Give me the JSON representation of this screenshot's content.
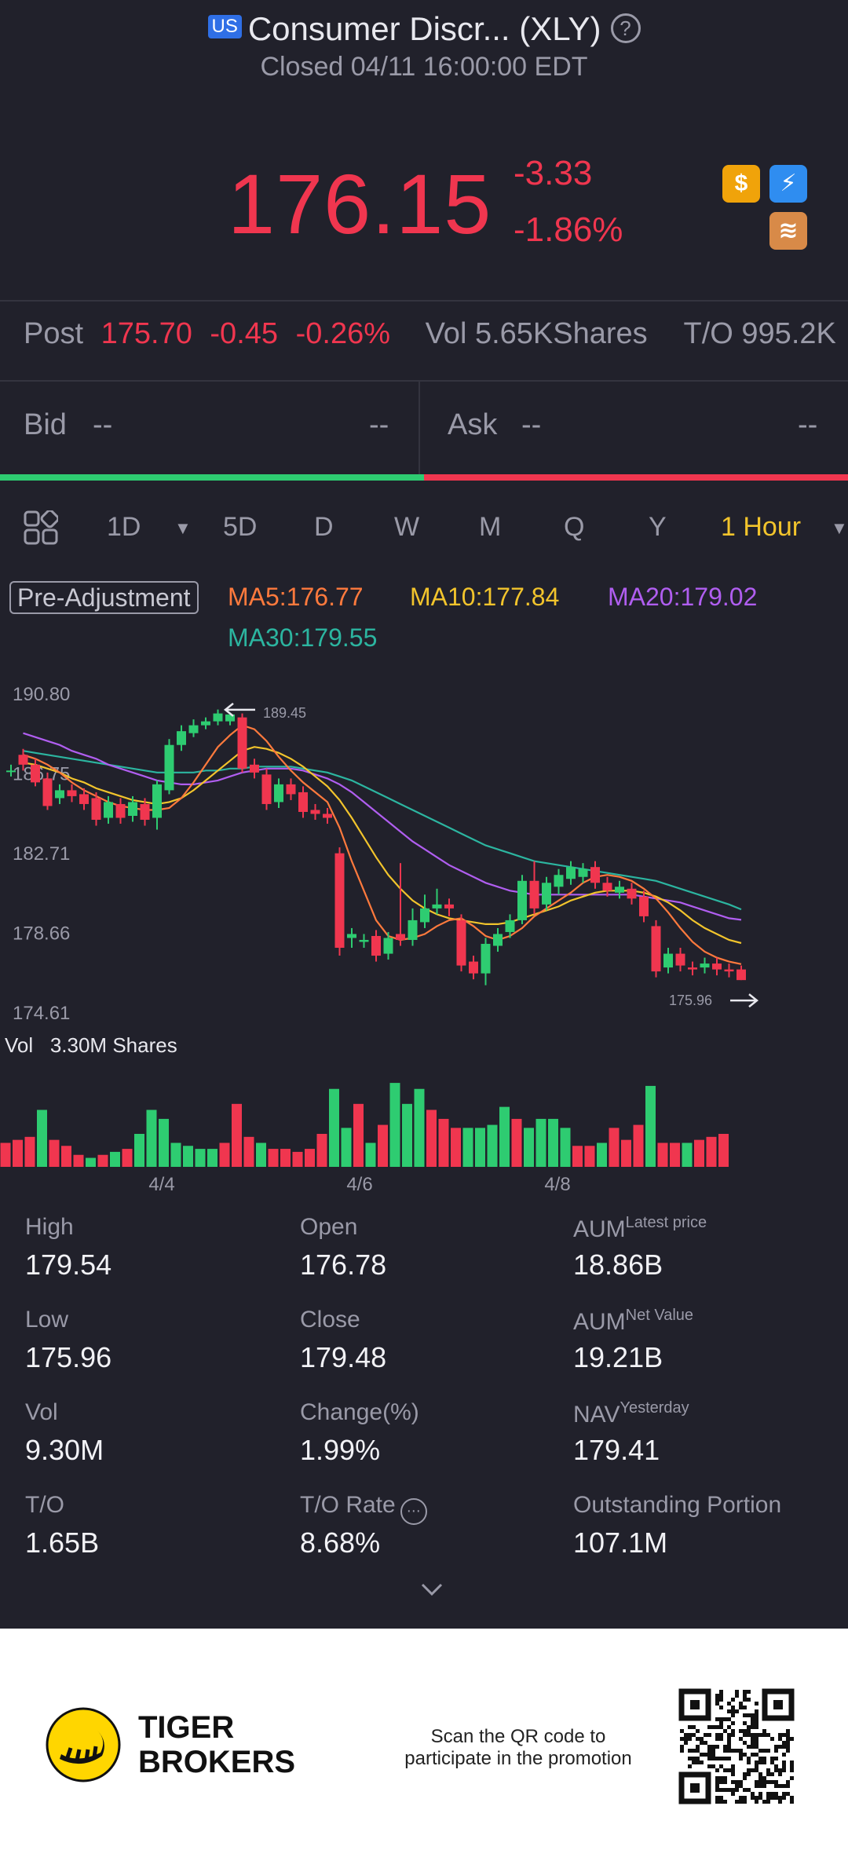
{
  "header": {
    "market_badge": "US",
    "title": "Consumer Discr... (XLY)",
    "status": "Closed 04/11 16:00:00 EDT"
  },
  "quote": {
    "price": "176.15",
    "change": "-3.33",
    "change_pct": "-1.86%"
  },
  "icons": {
    "dollar": "$",
    "flash": "⚡",
    "layers": "≋"
  },
  "post": {
    "label": "Post",
    "price": "175.70",
    "change": "-0.45",
    "change_pct": "-0.26%",
    "vol": "Vol 5.65KShares",
    "turnover": "T/O 995.2K"
  },
  "book": {
    "bid_label": "Bid",
    "bid_value": "--",
    "bid_size": "--",
    "ask_label": "Ask",
    "ask_value": "--",
    "ask_size": "--"
  },
  "tabs": {
    "t1": "1D",
    "t2": "5D",
    "t3": "D",
    "t4": "W",
    "t5": "M",
    "t6": "Q",
    "t7": "Y",
    "active": "1 Hour"
  },
  "ma": {
    "adjust": "Pre-Adjustment",
    "ma5": "MA5:176.77",
    "ma10": "MA10:177.84",
    "ma20": "MA20:179.02",
    "ma30": "MA30:179.55"
  },
  "colors": {
    "up": "#2ecc71",
    "down": "#f0364f",
    "ma5": "#ff7a3d",
    "ma10": "#f2c42c",
    "ma20": "#b05ef0",
    "ma30": "#2cb5a0",
    "accent_tab": "#f2c42c"
  },
  "chart_data": {
    "type": "candlestick",
    "y_ticks": [
      "190.80",
      "186.75",
      "182.71",
      "178.66",
      "174.61"
    ],
    "ylim": [
      174.61,
      190.8
    ],
    "high_marker": "189.45",
    "low_marker": "175.96",
    "x_ticks": [
      "4/4",
      "4/6",
      "4/8"
    ],
    "volume_label": "Vol",
    "volume_max": "3.30M Shares",
    "candles": [
      {
        "o": 186.6,
        "c": 186.6,
        "h": 186.9,
        "l": 186.3
      },
      {
        "o": 187.4,
        "c": 186.9,
        "h": 187.7,
        "l": 186.6
      },
      {
        "o": 186.9,
        "c": 186.0,
        "h": 187.2,
        "l": 185.8
      },
      {
        "o": 186.2,
        "c": 184.8,
        "h": 186.5,
        "l": 184.6
      },
      {
        "o": 185.2,
        "c": 185.6,
        "h": 185.9,
        "l": 184.9
      },
      {
        "o": 185.6,
        "c": 185.3,
        "h": 185.9,
        "l": 185.0
      },
      {
        "o": 185.4,
        "c": 184.9,
        "h": 185.7,
        "l": 184.6
      },
      {
        "o": 185.2,
        "c": 184.1,
        "h": 185.5,
        "l": 183.8
      },
      {
        "o": 184.2,
        "c": 185.0,
        "h": 185.3,
        "l": 183.9
      },
      {
        "o": 184.9,
        "c": 184.2,
        "h": 185.2,
        "l": 183.9
      },
      {
        "o": 184.3,
        "c": 185.0,
        "h": 185.3,
        "l": 184.0
      },
      {
        "o": 184.9,
        "c": 184.1,
        "h": 185.2,
        "l": 183.8
      },
      {
        "o": 184.2,
        "c": 185.9,
        "h": 186.1,
        "l": 183.6
      },
      {
        "o": 185.6,
        "c": 187.9,
        "h": 188.2,
        "l": 185.4
      },
      {
        "o": 187.9,
        "c": 188.6,
        "h": 188.9,
        "l": 187.6
      },
      {
        "o": 188.5,
        "c": 188.9,
        "h": 189.2,
        "l": 188.3
      },
      {
        "o": 188.9,
        "c": 189.1,
        "h": 189.3,
        "l": 188.7
      },
      {
        "o": 189.1,
        "c": 189.5,
        "h": 189.7,
        "l": 188.9
      },
      {
        "o": 189.1,
        "c": 189.45,
        "h": 189.45,
        "l": 188.9
      },
      {
        "o": 189.3,
        "c": 186.7,
        "h": 189.5,
        "l": 186.5
      },
      {
        "o": 186.9,
        "c": 186.5,
        "h": 187.2,
        "l": 186.2
      },
      {
        "o": 186.4,
        "c": 184.9,
        "h": 186.7,
        "l": 184.6
      },
      {
        "o": 185.0,
        "c": 185.9,
        "h": 186.2,
        "l": 184.7
      },
      {
        "o": 185.9,
        "c": 185.4,
        "h": 186.2,
        "l": 185.1
      },
      {
        "o": 185.5,
        "c": 184.5,
        "h": 185.8,
        "l": 184.2
      },
      {
        "o": 184.6,
        "c": 184.4,
        "h": 184.9,
        "l": 184.1
      },
      {
        "o": 184.4,
        "c": 184.2,
        "h": 184.7,
        "l": 183.9
      },
      {
        "o": 182.4,
        "c": 177.6,
        "h": 182.7,
        "l": 177.2
      },
      {
        "o": 178.1,
        "c": 178.3,
        "h": 178.6,
        "l": 177.6
      },
      {
        "o": 177.9,
        "c": 178.0,
        "h": 178.3,
        "l": 177.6
      },
      {
        "o": 178.2,
        "c": 177.2,
        "h": 178.5,
        "l": 176.9
      },
      {
        "o": 177.3,
        "c": 178.1,
        "h": 178.4,
        "l": 177.0
      },
      {
        "o": 178.3,
        "c": 178.0,
        "h": 181.9,
        "l": 177.7
      },
      {
        "o": 178.0,
        "c": 179.0,
        "h": 179.6,
        "l": 177.7
      },
      {
        "o": 178.9,
        "c": 179.6,
        "h": 180.3,
        "l": 178.6
      },
      {
        "o": 179.6,
        "c": 179.8,
        "h": 180.6,
        "l": 179.3
      },
      {
        "o": 179.8,
        "c": 179.6,
        "h": 180.1,
        "l": 179.2
      },
      {
        "o": 179.0,
        "c": 176.7,
        "h": 179.3,
        "l": 176.4
      },
      {
        "o": 176.9,
        "c": 176.3,
        "h": 177.2,
        "l": 176.0
      },
      {
        "o": 176.3,
        "c": 177.8,
        "h": 178.1,
        "l": 175.7
      },
      {
        "o": 177.7,
        "c": 178.3,
        "h": 178.6,
        "l": 177.4
      },
      {
        "o": 178.4,
        "c": 179.0,
        "h": 179.3,
        "l": 178.1
      },
      {
        "o": 179.0,
        "c": 181.0,
        "h": 181.3,
        "l": 178.8
      },
      {
        "o": 181.0,
        "c": 179.6,
        "h": 182.0,
        "l": 179.3
      },
      {
        "o": 179.8,
        "c": 180.9,
        "h": 181.2,
        "l": 179.5
      },
      {
        "o": 180.7,
        "c": 181.3,
        "h": 181.6,
        "l": 180.3
      },
      {
        "o": 181.1,
        "c": 181.7,
        "h": 182.0,
        "l": 180.8
      },
      {
        "o": 181.2,
        "c": 181.6,
        "h": 181.9,
        "l": 180.9
      },
      {
        "o": 181.7,
        "c": 180.9,
        "h": 182.0,
        "l": 180.6
      },
      {
        "o": 180.9,
        "c": 180.5,
        "h": 181.2,
        "l": 180.2
      },
      {
        "o": 180.4,
        "c": 180.7,
        "h": 181.0,
        "l": 180.1
      },
      {
        "o": 180.6,
        "c": 180.1,
        "h": 180.9,
        "l": 179.8
      },
      {
        "o": 180.2,
        "c": 179.2,
        "h": 180.5,
        "l": 178.9
      },
      {
        "o": 178.7,
        "c": 176.4,
        "h": 179.0,
        "l": 176.1
      },
      {
        "o": 176.6,
        "c": 177.3,
        "h": 177.6,
        "l": 176.3
      },
      {
        "o": 177.3,
        "c": 176.7,
        "h": 177.6,
        "l": 176.4
      },
      {
        "o": 176.6,
        "c": 176.5,
        "h": 176.9,
        "l": 176.2
      },
      {
        "o": 176.6,
        "c": 176.8,
        "h": 177.1,
        "l": 176.3
      },
      {
        "o": 176.8,
        "c": 176.5,
        "h": 177.1,
        "l": 176.2
      },
      {
        "o": 176.5,
        "c": 176.4,
        "h": 176.8,
        "l": 176.1
      },
      {
        "o": 176.5,
        "c": 175.96,
        "h": 176.7,
        "l": 175.96
      }
    ],
    "ma_lines": {
      "ma5": [
        187.4,
        187.2,
        186.9,
        186.5,
        186.0,
        185.6,
        185.3,
        185.0,
        184.8,
        184.7,
        184.6,
        184.6,
        184.7,
        185.2,
        186.0,
        186.9,
        187.8,
        188.4,
        188.9,
        188.7,
        188.1,
        187.3,
        186.6,
        186.0,
        185.5,
        185.0,
        183.7,
        182.0,
        180.5,
        179.0,
        178.2,
        178.0,
        178.1,
        178.3,
        178.7,
        179.0,
        179.1,
        178.7,
        178.2,
        178.0,
        178.2,
        178.6,
        179.2,
        179.6,
        180.0,
        180.4,
        180.9,
        181.2,
        181.3,
        181.2,
        181.0,
        180.6,
        180.1,
        179.4,
        178.6,
        177.9,
        177.4,
        177.1,
        176.9,
        176.77
      ],
      "ma10": [
        187.0,
        186.9,
        186.7,
        186.5,
        186.2,
        186.0,
        185.7,
        185.5,
        185.3,
        185.1,
        185.0,
        184.9,
        185.0,
        185.2,
        185.6,
        186.1,
        186.6,
        187.1,
        187.6,
        187.8,
        187.7,
        187.5,
        187.2,
        186.8,
        186.3,
        185.8,
        185.1,
        184.2,
        183.2,
        182.2,
        181.3,
        180.6,
        180.0,
        179.6,
        179.3,
        179.1,
        179.0,
        178.9,
        178.8,
        178.8,
        178.9,
        179.1,
        179.3,
        179.5,
        179.7,
        180.0,
        180.2,
        180.4,
        180.5,
        180.5,
        180.5,
        180.4,
        180.2,
        179.9,
        179.5,
        179.0,
        178.6,
        178.3,
        178.0,
        177.84
      ],
      "ma20": [
        188.5,
        188.3,
        188.1,
        187.9,
        187.6,
        187.4,
        187.2,
        186.9,
        186.7,
        186.5,
        186.3,
        186.1,
        186.0,
        185.9,
        185.9,
        186.0,
        186.1,
        186.3,
        186.5,
        186.6,
        186.7,
        186.7,
        186.7,
        186.6,
        186.4,
        186.2,
        185.9,
        185.5,
        185.0,
        184.5,
        184.0,
        183.5,
        183.0,
        182.6,
        182.2,
        181.8,
        181.5,
        181.2,
        180.9,
        180.7,
        180.5,
        180.4,
        180.3,
        180.3,
        180.3,
        180.3,
        180.3,
        180.3,
        180.3,
        180.3,
        180.3,
        180.2,
        180.1,
        180.0,
        179.9,
        179.7,
        179.5,
        179.3,
        179.1,
        179.02
      ],
      "ma30": [
        187.6,
        187.5,
        187.4,
        187.3,
        187.2,
        187.1,
        187.0,
        186.9,
        186.8,
        186.7,
        186.6,
        186.5,
        186.5,
        186.5,
        186.5,
        186.6,
        186.6,
        186.7,
        186.7,
        186.8,
        186.8,
        186.8,
        186.8,
        186.7,
        186.6,
        186.5,
        186.3,
        186.1,
        185.8,
        185.5,
        185.2,
        184.9,
        184.6,
        184.3,
        184.0,
        183.7,
        183.4,
        183.1,
        182.8,
        182.6,
        182.4,
        182.2,
        182.0,
        181.9,
        181.8,
        181.7,
        181.6,
        181.5,
        181.4,
        181.3,
        181.2,
        181.1,
        181.0,
        180.8,
        180.6,
        180.4,
        180.2,
        180.0,
        179.8,
        179.55
      ]
    },
    "volumes": [
      0.8,
      0.9,
      1.0,
      1.9,
      0.9,
      0.7,
      0.4,
      0.3,
      0.4,
      0.5,
      0.6,
      1.1,
      1.9,
      1.6,
      0.8,
      0.7,
      0.6,
      0.6,
      0.8,
      2.1,
      1.0,
      0.8,
      0.6,
      0.6,
      0.5,
      0.6,
      1.1,
      2.6,
      1.3,
      2.1,
      0.8,
      1.4,
      2.8,
      2.1,
      2.6,
      1.9,
      1.6,
      1.3,
      1.3,
      1.3,
      1.4,
      2.0,
      1.6,
      1.3,
      1.6,
      1.6,
      1.3,
      0.7,
      0.7,
      0.8,
      1.3,
      0.9,
      1.4,
      2.7,
      0.8,
      0.8,
      0.8,
      0.9,
      1.0,
      1.1
    ]
  },
  "stats": {
    "high_label": "High",
    "high": "179.54",
    "open_label": "Open",
    "open": "176.78",
    "aum1_label": "AUM",
    "aum1_sup": "Latest price",
    "aum1": "18.86B",
    "low_label": "Low",
    "low": "175.96",
    "close_label": "Close",
    "close": "179.48",
    "aum2_label": "AUM",
    "aum2_sup": "Net Value",
    "aum2": "19.21B",
    "vol_label": "Vol",
    "vol": "9.30M",
    "chg_label": "Change(%)",
    "chg": "1.99%",
    "nav_label": "NAV",
    "nav_sup": "Yesterday",
    "nav": "179.41",
    "to_label": "T/O",
    "to": "1.65B",
    "torate_label": "T/O Rate",
    "torate": "8.68%",
    "outstanding_label": "Outstanding Portion",
    "outstanding": "107.1M"
  },
  "footer": {
    "brand_line1": "TIGER",
    "brand_line2": "BROKERS",
    "promo": "Scan the QR code to participate in the promotion"
  }
}
